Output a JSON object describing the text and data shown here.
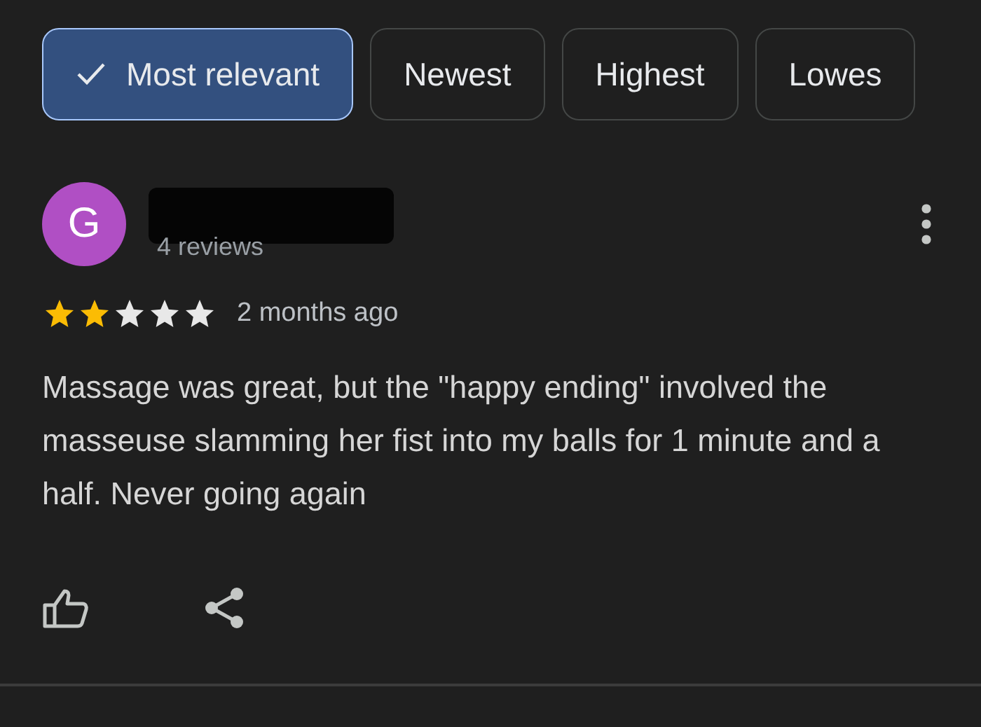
{
  "filters": [
    {
      "label": "Most relevant",
      "selected": true
    },
    {
      "label": "Newest",
      "selected": false
    },
    {
      "label": "Highest",
      "selected": false
    },
    {
      "label": "Lowes",
      "selected": false
    }
  ],
  "review": {
    "avatar_letter": "G",
    "reviewer_stats": "4 reviews",
    "stars": 2,
    "time": "2 months ago",
    "text": "Massage was great, but the \"happy ending\" involved the masseuse slamming her fist into my balls for 1 minute and a half. Never going again"
  }
}
